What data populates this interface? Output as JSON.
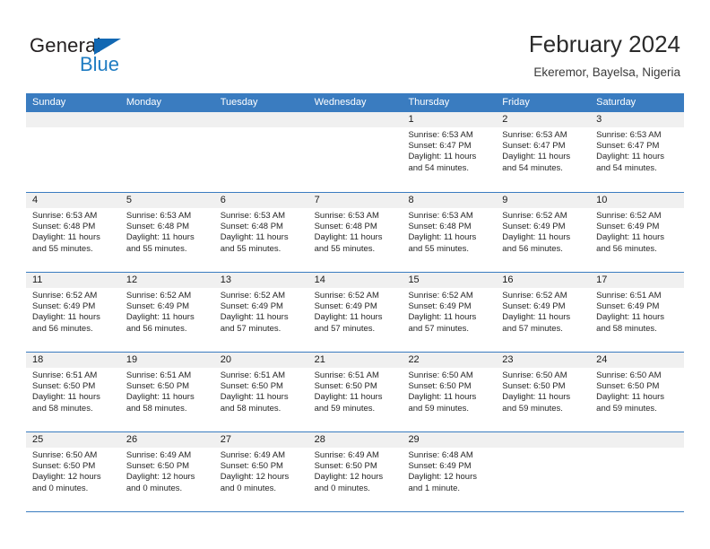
{
  "brand": {
    "name_part1": "General",
    "name_part2": "Blue"
  },
  "header": {
    "title": "February 2024",
    "subtitle": "Ekeremor, Bayelsa, Nigeria"
  },
  "colors": {
    "header_blue": "#3a7cc0",
    "brand_blue": "#1f7cc2",
    "day_band": "#f0f0f0"
  },
  "weekdays": [
    "Sunday",
    "Monday",
    "Tuesday",
    "Wednesday",
    "Thursday",
    "Friday",
    "Saturday"
  ],
  "weeks": [
    [
      {
        "day": "",
        "lines": []
      },
      {
        "day": "",
        "lines": []
      },
      {
        "day": "",
        "lines": []
      },
      {
        "day": "",
        "lines": []
      },
      {
        "day": "1",
        "lines": [
          "Sunrise: 6:53 AM",
          "Sunset: 6:47 PM",
          "Daylight: 11 hours and 54 minutes."
        ]
      },
      {
        "day": "2",
        "lines": [
          "Sunrise: 6:53 AM",
          "Sunset: 6:47 PM",
          "Daylight: 11 hours and 54 minutes."
        ]
      },
      {
        "day": "3",
        "lines": [
          "Sunrise: 6:53 AM",
          "Sunset: 6:47 PM",
          "Daylight: 11 hours and 54 minutes."
        ]
      }
    ],
    [
      {
        "day": "4",
        "lines": [
          "Sunrise: 6:53 AM",
          "Sunset: 6:48 PM",
          "Daylight: 11 hours and 55 minutes."
        ]
      },
      {
        "day": "5",
        "lines": [
          "Sunrise: 6:53 AM",
          "Sunset: 6:48 PM",
          "Daylight: 11 hours and 55 minutes."
        ]
      },
      {
        "day": "6",
        "lines": [
          "Sunrise: 6:53 AM",
          "Sunset: 6:48 PM",
          "Daylight: 11 hours and 55 minutes."
        ]
      },
      {
        "day": "7",
        "lines": [
          "Sunrise: 6:53 AM",
          "Sunset: 6:48 PM",
          "Daylight: 11 hours and 55 minutes."
        ]
      },
      {
        "day": "8",
        "lines": [
          "Sunrise: 6:53 AM",
          "Sunset: 6:48 PM",
          "Daylight: 11 hours and 55 minutes."
        ]
      },
      {
        "day": "9",
        "lines": [
          "Sunrise: 6:52 AM",
          "Sunset: 6:49 PM",
          "Daylight: 11 hours and 56 minutes."
        ]
      },
      {
        "day": "10",
        "lines": [
          "Sunrise: 6:52 AM",
          "Sunset: 6:49 PM",
          "Daylight: 11 hours and 56 minutes."
        ]
      }
    ],
    [
      {
        "day": "11",
        "lines": [
          "Sunrise: 6:52 AM",
          "Sunset: 6:49 PM",
          "Daylight: 11 hours and 56 minutes."
        ]
      },
      {
        "day": "12",
        "lines": [
          "Sunrise: 6:52 AM",
          "Sunset: 6:49 PM",
          "Daylight: 11 hours and 56 minutes."
        ]
      },
      {
        "day": "13",
        "lines": [
          "Sunrise: 6:52 AM",
          "Sunset: 6:49 PM",
          "Daylight: 11 hours and 57 minutes."
        ]
      },
      {
        "day": "14",
        "lines": [
          "Sunrise: 6:52 AM",
          "Sunset: 6:49 PM",
          "Daylight: 11 hours and 57 minutes."
        ]
      },
      {
        "day": "15",
        "lines": [
          "Sunrise: 6:52 AM",
          "Sunset: 6:49 PM",
          "Daylight: 11 hours and 57 minutes."
        ]
      },
      {
        "day": "16",
        "lines": [
          "Sunrise: 6:52 AM",
          "Sunset: 6:49 PM",
          "Daylight: 11 hours and 57 minutes."
        ]
      },
      {
        "day": "17",
        "lines": [
          "Sunrise: 6:51 AM",
          "Sunset: 6:49 PM",
          "Daylight: 11 hours and 58 minutes."
        ]
      }
    ],
    [
      {
        "day": "18",
        "lines": [
          "Sunrise: 6:51 AM",
          "Sunset: 6:50 PM",
          "Daylight: 11 hours and 58 minutes."
        ]
      },
      {
        "day": "19",
        "lines": [
          "Sunrise: 6:51 AM",
          "Sunset: 6:50 PM",
          "Daylight: 11 hours and 58 minutes."
        ]
      },
      {
        "day": "20",
        "lines": [
          "Sunrise: 6:51 AM",
          "Sunset: 6:50 PM",
          "Daylight: 11 hours and 58 minutes."
        ]
      },
      {
        "day": "21",
        "lines": [
          "Sunrise: 6:51 AM",
          "Sunset: 6:50 PM",
          "Daylight: 11 hours and 59 minutes."
        ]
      },
      {
        "day": "22",
        "lines": [
          "Sunrise: 6:50 AM",
          "Sunset: 6:50 PM",
          "Daylight: 11 hours and 59 minutes."
        ]
      },
      {
        "day": "23",
        "lines": [
          "Sunrise: 6:50 AM",
          "Sunset: 6:50 PM",
          "Daylight: 11 hours and 59 minutes."
        ]
      },
      {
        "day": "24",
        "lines": [
          "Sunrise: 6:50 AM",
          "Sunset: 6:50 PM",
          "Daylight: 11 hours and 59 minutes."
        ]
      }
    ],
    [
      {
        "day": "25",
        "lines": [
          "Sunrise: 6:50 AM",
          "Sunset: 6:50 PM",
          "Daylight: 12 hours and 0 minutes."
        ]
      },
      {
        "day": "26",
        "lines": [
          "Sunrise: 6:49 AM",
          "Sunset: 6:50 PM",
          "Daylight: 12 hours and 0 minutes."
        ]
      },
      {
        "day": "27",
        "lines": [
          "Sunrise: 6:49 AM",
          "Sunset: 6:50 PM",
          "Daylight: 12 hours and 0 minutes."
        ]
      },
      {
        "day": "28",
        "lines": [
          "Sunrise: 6:49 AM",
          "Sunset: 6:50 PM",
          "Daylight: 12 hours and 0 minutes."
        ]
      },
      {
        "day": "29",
        "lines": [
          "Sunrise: 6:48 AM",
          "Sunset: 6:49 PM",
          "Daylight: 12 hours and 1 minute."
        ]
      },
      {
        "day": "",
        "lines": []
      },
      {
        "day": "",
        "lines": []
      }
    ]
  ]
}
